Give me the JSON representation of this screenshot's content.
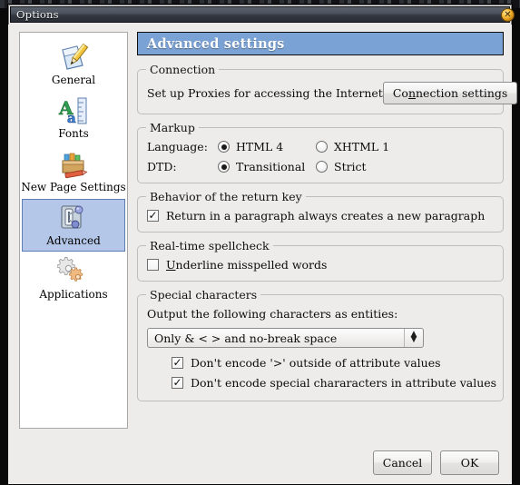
{
  "window": {
    "title": "Options",
    "close_icon": "close-circle-icon"
  },
  "sidebar": {
    "items": [
      {
        "label": "General",
        "icon": "pencil-document-icon",
        "selected": false
      },
      {
        "label": "Fonts",
        "icon": "font-ruler-icon",
        "selected": false
      },
      {
        "label": "New Page Settings",
        "icon": "crayon-box-icon",
        "selected": false
      },
      {
        "label": "Advanced",
        "icon": "switch-nodes-icon",
        "selected": true
      },
      {
        "label": "Applications",
        "icon": "gears-icon",
        "selected": false
      }
    ]
  },
  "panel": {
    "header_title": "Advanced settings",
    "connection": {
      "legend": "Connection",
      "description": "Set up Proxies for accessing the Internet",
      "button_pre": "Co",
      "button_mnemonic": "n",
      "button_post": "nection settings"
    },
    "markup": {
      "legend": "Markup",
      "language_label": "Language:",
      "dtd_label": "DTD:",
      "language_options": [
        {
          "label": "HTML 4",
          "selected": true
        },
        {
          "label": "XHTML 1",
          "selected": false
        }
      ],
      "dtd_options": [
        {
          "label": "Transitional",
          "selected": true
        },
        {
          "label": "Strict",
          "selected": false
        }
      ]
    },
    "return_key": {
      "legend": "Behavior of the return key",
      "checkbox_label": "Return in a paragraph always creates a new paragraph",
      "checked": true
    },
    "spellcheck": {
      "legend": "Real-time spellcheck",
      "checkbox_mnemonic": "U",
      "checkbox_label_rest": "nderline misspelled words",
      "checked": false
    },
    "special_characters": {
      "legend": "Special characters",
      "description": "Output the following characters as entities:",
      "select_value": "Only & < > and no-break space",
      "checkbox_1_label": "Don't encode '>' outside of attribute values",
      "checkbox_1_checked": true,
      "checkbox_2_label": "Don't encode special chararacters in attribute values",
      "checkbox_2_checked": true
    }
  },
  "footer": {
    "cancel_label": "Cancel",
    "ok_label": "OK"
  },
  "colors": {
    "header_blue": "#7ba2d4",
    "selection_blue": "#b5c7e8",
    "titlebar_dark": "#4b525c",
    "close_orange": "#f4b731"
  }
}
